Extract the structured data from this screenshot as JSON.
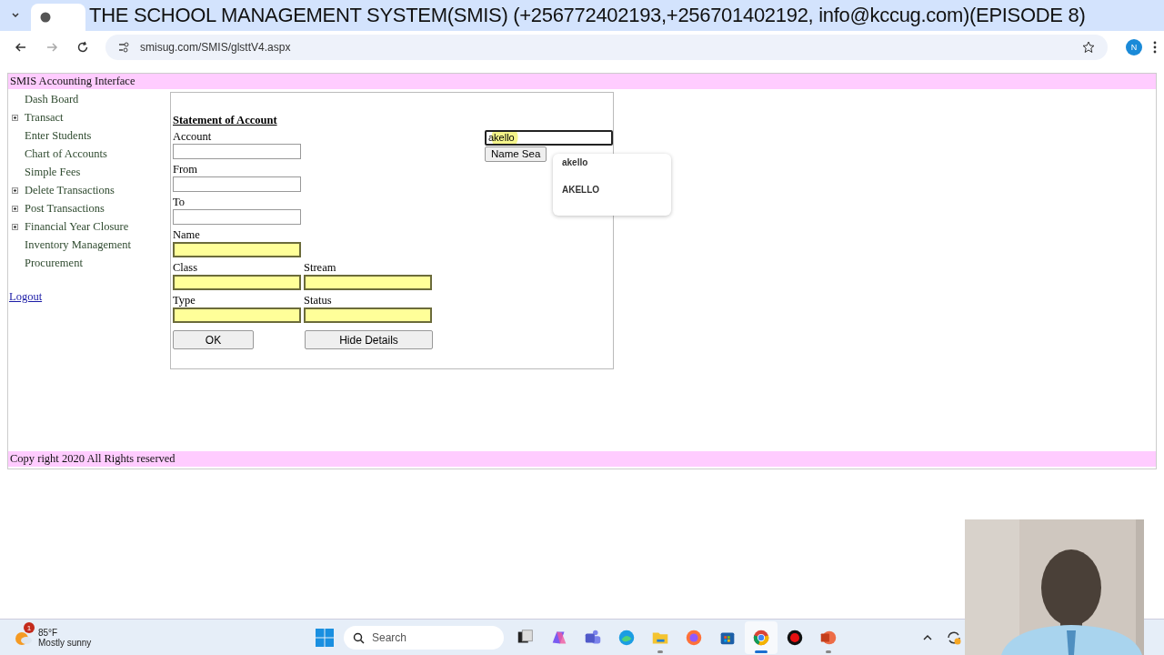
{
  "video_caption": "THE SCHOOL MANAGEMENT SYSTEM(SMIS) (+256772402193,+256701402192, info@kccug.com)(EPISODE 8)",
  "browser": {
    "url": "smisug.com/SMIS/glsttV4.aspx",
    "profile_initial": "N"
  },
  "page": {
    "header": "SMIS Accounting Interface",
    "sidebar": {
      "items": [
        {
          "label": "Dash Board",
          "expandable": false
        },
        {
          "label": "Transact",
          "expandable": true
        },
        {
          "label": "Enter Students",
          "expandable": false
        },
        {
          "label": "Chart of Accounts",
          "expandable": false
        },
        {
          "label": "Simple Fees",
          "expandable": false
        },
        {
          "label": "Delete Transactions",
          "expandable": true
        },
        {
          "label": "Post Transactions",
          "expandable": true
        },
        {
          "label": "Financial Year Closure",
          "expandable": true
        },
        {
          "label": "Inventory Management",
          "expandable": false
        },
        {
          "label": "Procurement",
          "expandable": false
        }
      ],
      "logout": "Logout"
    },
    "form": {
      "title": "Statement of Account",
      "rows": [
        [
          {
            "label": "Account",
            "highlighted": false
          }
        ],
        [
          {
            "label": "From",
            "highlighted": false
          }
        ],
        [
          {
            "label": "To",
            "highlighted": false
          }
        ],
        [
          {
            "label": "Name",
            "highlighted": true
          }
        ],
        [
          {
            "label": "Class",
            "highlighted": true
          },
          {
            "label": "Stream",
            "highlighted": true
          }
        ],
        [
          {
            "label": "Type",
            "highlighted": true
          },
          {
            "label": "Status",
            "highlighted": true
          }
        ]
      ],
      "buttons": [
        "OK",
        "Hide Details"
      ],
      "search": {
        "value": "akello",
        "button": "Name Sea",
        "suggestions": [
          "akello",
          "AKELLO"
        ]
      }
    },
    "footer": "Copy right 2020 All Rights reserved"
  },
  "taskbar": {
    "weather": {
      "badge": "1",
      "temperature": "85°F",
      "condition": "Mostly sunny"
    },
    "search_placeholder": "Search",
    "apps": [
      {
        "kind": "taskview",
        "running": false,
        "selected": false
      },
      {
        "kind": "copilot",
        "running": false,
        "selected": false
      },
      {
        "kind": "teams",
        "running": false,
        "selected": false
      },
      {
        "kind": "edge",
        "running": false,
        "selected": false
      },
      {
        "kind": "folder",
        "running": true,
        "selected": false
      },
      {
        "kind": "firefox",
        "running": false,
        "selected": false
      },
      {
        "kind": "store",
        "running": false,
        "selected": false
      },
      {
        "kind": "chrome",
        "running": true,
        "selected": true
      },
      {
        "kind": "record",
        "running": false,
        "selected": false
      },
      {
        "kind": "powerpoint",
        "running": true,
        "selected": false
      }
    ]
  }
}
